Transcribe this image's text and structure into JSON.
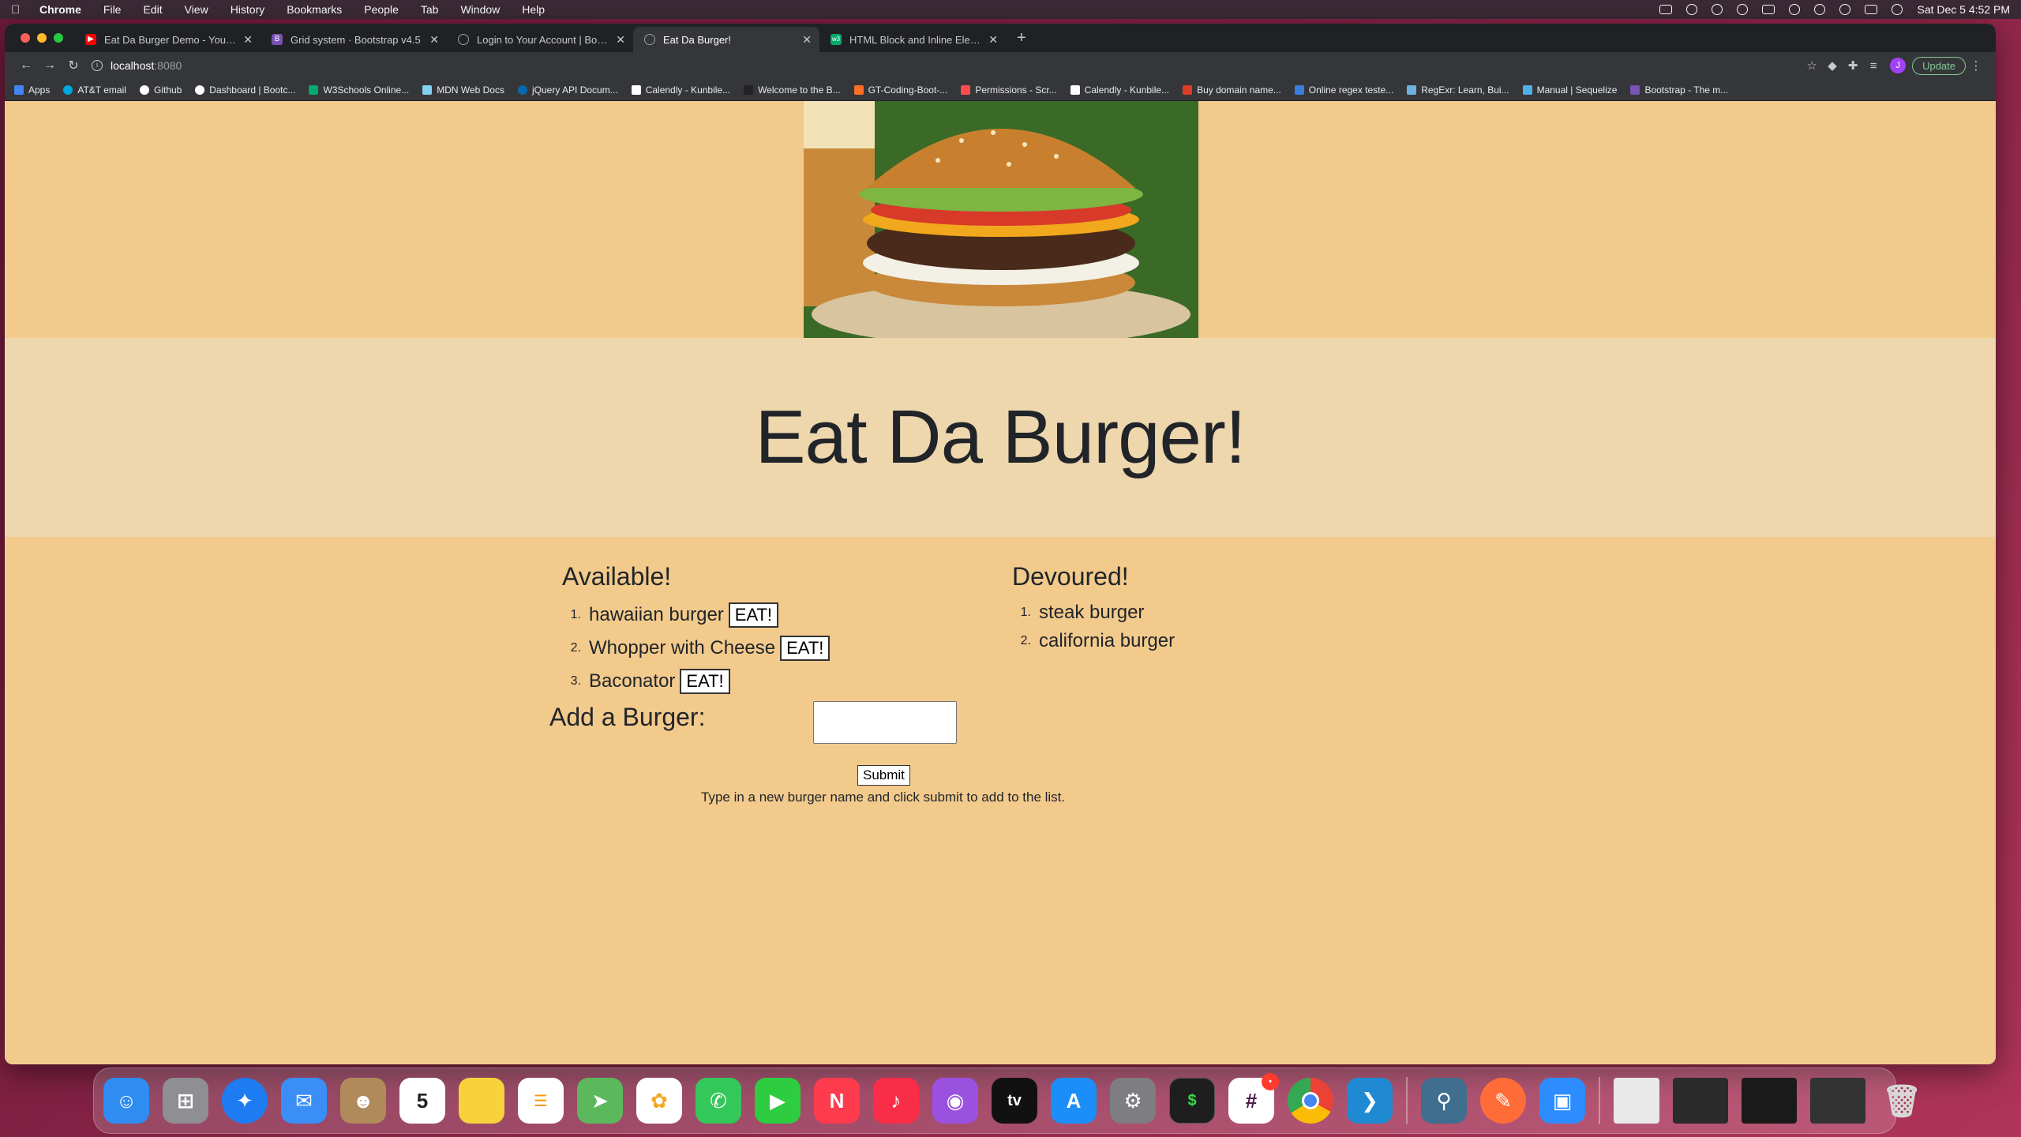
{
  "menubar": {
    "app_name": "Chrome",
    "menus": [
      "File",
      "Edit",
      "View",
      "History",
      "Bookmarks",
      "People",
      "Tab",
      "Window",
      "Help"
    ],
    "clock": "Sat Dec 5  4:52 PM"
  },
  "tabs": [
    {
      "label": "Eat Da Burger Demo - YouTube",
      "favicon_color": "#ff0000",
      "active": false
    },
    {
      "label": "Grid system · Bootstrap v4.5",
      "favicon_color": "#7952b3",
      "favicon_text": "B",
      "active": false
    },
    {
      "label": "Login to Your Account | Bootca",
      "favicon_color": "#5f6368",
      "active": false
    },
    {
      "label": "Eat Da Burger!",
      "favicon_color": "#5f6368",
      "active": true
    },
    {
      "label": "HTML Block and Inline Elements",
      "favicon_color": "#04aa6d",
      "active": false
    }
  ],
  "toolbar": {
    "url_host": "localhost",
    "url_port": ":8080",
    "update_label": "Update",
    "profile_initial": "J"
  },
  "bookmarks": [
    {
      "label": "Apps",
      "color": "#4285f4"
    },
    {
      "label": "AT&T email",
      "color": "#00a8e0"
    },
    {
      "label": "Github",
      "color": "#ffffff"
    },
    {
      "label": "Dashboard | Bootc...",
      "color": "#ffffff"
    },
    {
      "label": "W3Schools Online...",
      "color": "#04aa6d"
    },
    {
      "label": "MDN Web Docs",
      "color": "#83d0f2"
    },
    {
      "label": "jQuery API Docum...",
      "color": "#0769ad"
    },
    {
      "label": "Calendly - Kunbile...",
      "color": "#ffffff"
    },
    {
      "label": "Welcome to the B...",
      "color": "#222222"
    },
    {
      "label": "GT-Coding-Boot-...",
      "color": "#fc6d26"
    },
    {
      "label": "Permissions - Scr...",
      "color": "#ff4d4d"
    },
    {
      "label": "Calendly - Kunbile...",
      "color": "#ffffff"
    },
    {
      "label": "Buy domain name...",
      "color": "#dd3d24"
    },
    {
      "label": "Online regex teste...",
      "color": "#3b7ddd"
    },
    {
      "label": "RegExr: Learn, Bui...",
      "color": "#70b0e0"
    },
    {
      "label": "Manual | Sequelize",
      "color": "#52b0e7"
    },
    {
      "label": "Bootstrap - The m...",
      "color": "#7952b3"
    }
  ],
  "page": {
    "title": "Eat Da Burger!",
    "available_title": "Available!",
    "available": [
      {
        "num": "1.",
        "name": "hawaiian burger",
        "button": "EAT!"
      },
      {
        "num": "2.",
        "name": "Whopper with Cheese",
        "button": "EAT!"
      },
      {
        "num": "3.",
        "name": "Baconator",
        "button": "EAT!"
      }
    ],
    "devoured_title": "Devoured!",
    "devoured": [
      {
        "num": "1.",
        "name": "steak burger"
      },
      {
        "num": "2.",
        "name": "california burger"
      }
    ],
    "add_label": "Add a Burger:",
    "input_value": "",
    "submit_label": "Submit",
    "hint": "Type in a new burger name and click submit to add to the list."
  },
  "dock": {
    "apps": [
      {
        "name": "finder-icon",
        "color": "#2f8cf0",
        "glyph": ""
      },
      {
        "name": "launchpad-icon",
        "color": "#8e8e93",
        "glyph": ""
      },
      {
        "name": "safari-icon",
        "color": "#1e7cf2",
        "glyph": ""
      },
      {
        "name": "mail-icon",
        "color": "#3a8ef6",
        "glyph": ""
      },
      {
        "name": "contacts-icon",
        "color": "#b08a5a",
        "glyph": ""
      },
      {
        "name": "calendar-icon",
        "color": "#ffffff",
        "glyph": "5"
      },
      {
        "name": "notes-icon",
        "color": "#f7d23b",
        "glyph": ""
      },
      {
        "name": "reminders-icon",
        "color": "#ffffff",
        "glyph": ""
      },
      {
        "name": "maps-icon",
        "color": "#5cb85c",
        "glyph": ""
      },
      {
        "name": "photos-icon",
        "color": "#f5a623",
        "glyph": ""
      },
      {
        "name": "messages-icon",
        "color": "#34c759",
        "glyph": ""
      },
      {
        "name": "facetime-icon",
        "color": "#2ecc40",
        "glyph": ""
      },
      {
        "name": "news-icon",
        "color": "#ff3b4e",
        "glyph": ""
      },
      {
        "name": "music-icon",
        "color": "#fa2d48",
        "glyph": "♪"
      },
      {
        "name": "podcasts-icon",
        "color": "#9b51e0",
        "glyph": ""
      },
      {
        "name": "tv-icon",
        "color": "#111111",
        "glyph": "tv"
      },
      {
        "name": "app-store-icon",
        "color": "#1c8ef9",
        "glyph": "A"
      },
      {
        "name": "system-preferences-icon",
        "color": "#7d7d82",
        "glyph": "⚙"
      },
      {
        "name": "terminal-icon",
        "color": "#1e1e1e",
        "glyph": "$"
      },
      {
        "name": "slack-icon",
        "color": "#ffffff",
        "glyph": "#"
      },
      {
        "name": "chrome-icon",
        "color": "#e8453c",
        "glyph": ""
      },
      {
        "name": "vscode-icon",
        "color": "#1f8ad2",
        "glyph": ""
      },
      {
        "name": "mysql-workbench-icon",
        "color": "#3f6e8f",
        "glyph": ""
      },
      {
        "name": "postman-icon",
        "color": "#ff6c37",
        "glyph": ""
      },
      {
        "name": "zoom-icon",
        "color": "#2d8cff",
        "glyph": ""
      },
      {
        "name": "preview-thumbnail-icon",
        "color": "#e9e9e9",
        "glyph": ""
      },
      {
        "name": "window-thumbnail-1-icon",
        "color": "#2b2b2b",
        "glyph": ""
      },
      {
        "name": "window-thumbnail-2-icon",
        "color": "#1a1a1a",
        "glyph": ""
      },
      {
        "name": "window-thumbnail-3-icon",
        "color": "#333333",
        "glyph": ""
      },
      {
        "name": "trash-icon",
        "color": "#c8c8c8",
        "glyph": ""
      }
    ],
    "slack_badge": "•"
  }
}
